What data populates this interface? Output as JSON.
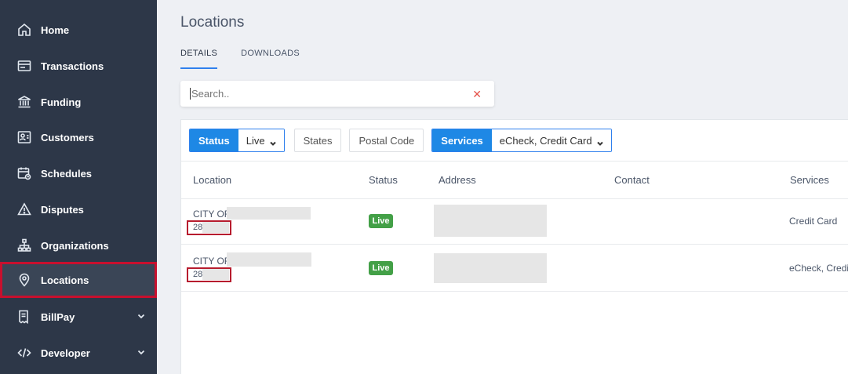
{
  "sidebar": {
    "items": [
      {
        "label": "Home",
        "icon": "home-icon"
      },
      {
        "label": "Transactions",
        "icon": "receipt-icon"
      },
      {
        "label": "Funding",
        "icon": "bank-icon"
      },
      {
        "label": "Customers",
        "icon": "customers-icon"
      },
      {
        "label": "Schedules",
        "icon": "calendar-icon"
      },
      {
        "label": "Disputes",
        "icon": "warning-icon"
      },
      {
        "label": "Organizations",
        "icon": "hierarchy-icon"
      },
      {
        "label": "Locations",
        "icon": "map-pin-icon",
        "active": true
      },
      {
        "label": "BillPay",
        "icon": "bill-icon",
        "expandable": true
      },
      {
        "label": "Developer",
        "icon": "code-icon",
        "expandable": true
      }
    ]
  },
  "page": {
    "title": "Locations"
  },
  "tabs": [
    {
      "label": "DETAILS",
      "active": true
    },
    {
      "label": "DOWNLOADS",
      "active": false
    }
  ],
  "search": {
    "placeholder": "Search..",
    "value": "",
    "clear_icon": "close-icon"
  },
  "filters": {
    "status": {
      "label": "Status",
      "value": "Live"
    },
    "states": {
      "label": "States"
    },
    "postal": {
      "label": "Postal Code"
    },
    "services": {
      "label": "Services",
      "value": "eCheck, Credit Card"
    }
  },
  "table": {
    "columns": [
      "Location",
      "Status",
      "Address",
      "Contact",
      "Services"
    ],
    "rows": [
      {
        "name": "CITY OF",
        "id": "28",
        "status": "Live",
        "services": "Credit Card"
      },
      {
        "name": "CITY OF",
        "id": "28",
        "status": "Live",
        "services": "eCheck, Credit Card"
      }
    ]
  },
  "colors": {
    "accent": "#1e88e5",
    "sidebar": "#2d3748",
    "highlight": "#c8102e",
    "live": "#43a047",
    "clear": "#e5534b"
  }
}
